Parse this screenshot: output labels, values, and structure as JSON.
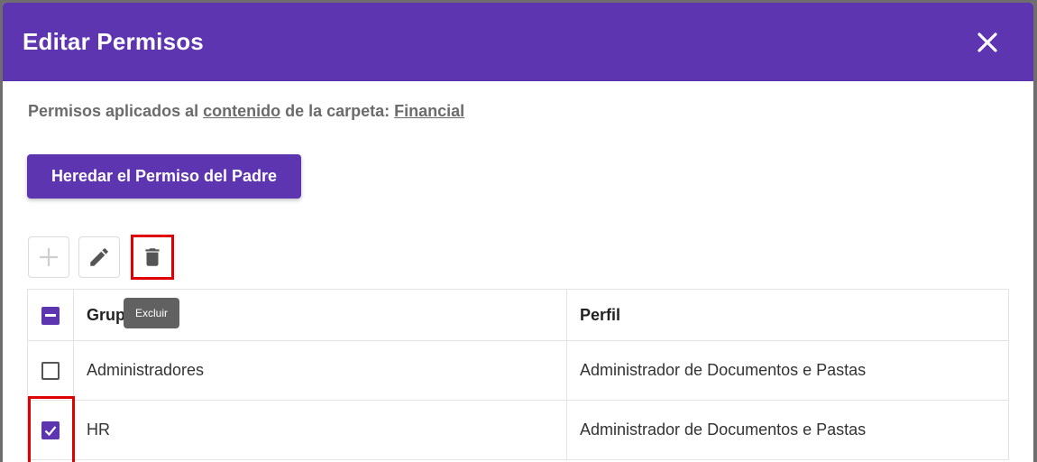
{
  "dialog": {
    "title": "Editar Permisos",
    "close_icon": "close-icon"
  },
  "subtitle": {
    "prefix": "Permisos aplicados al ",
    "link1": "contenido",
    "middle": " de la carpeta: ",
    "link2": "Financial"
  },
  "inherit_button": {
    "label": "Heredar el Permiso del Padre"
  },
  "toolbar": {
    "add_icon": "plus-icon",
    "edit_icon": "pencil-icon",
    "delete_icon": "trash-icon",
    "tooltip": "Excluir"
  },
  "table": {
    "columns": [
      "Grupo",
      "Perfil"
    ],
    "header_grupo_visible": "Grup",
    "rows": [
      {
        "checked": false,
        "grupo": "Administradores",
        "perfil": "Administrador de Documentos e Pastas"
      },
      {
        "checked": true,
        "grupo": "HR",
        "perfil": "Administrador de Documentos e Pastas"
      }
    ]
  },
  "colors": {
    "accent": "#5e35b1",
    "highlight": "#e00000",
    "tooltip_bg": "#616161"
  }
}
